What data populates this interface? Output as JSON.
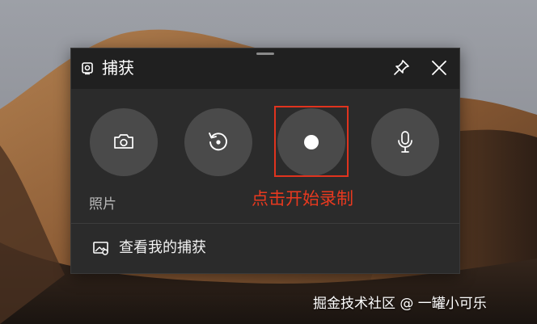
{
  "window": {
    "title": "捕获",
    "title_icon": "capture-icon",
    "pin_icon": "pin-icon",
    "close_icon": "close-icon"
  },
  "buttons": {
    "screenshot_icon": "camera-icon",
    "recent_icon": "rewind-icon",
    "record_icon": "record-icon",
    "mic_icon": "microphone-icon"
  },
  "labels": {
    "photo": "照片",
    "annotation": "点击开始录制",
    "gallery": "查看我的捕获"
  },
  "watermark": "掘金技术社区 @ 一罐小可乐",
  "colors": {
    "panel": "#2b2b2b",
    "titlebar": "#202020",
    "button": "#4a4a4a",
    "annotation_red": "#e0331e"
  }
}
